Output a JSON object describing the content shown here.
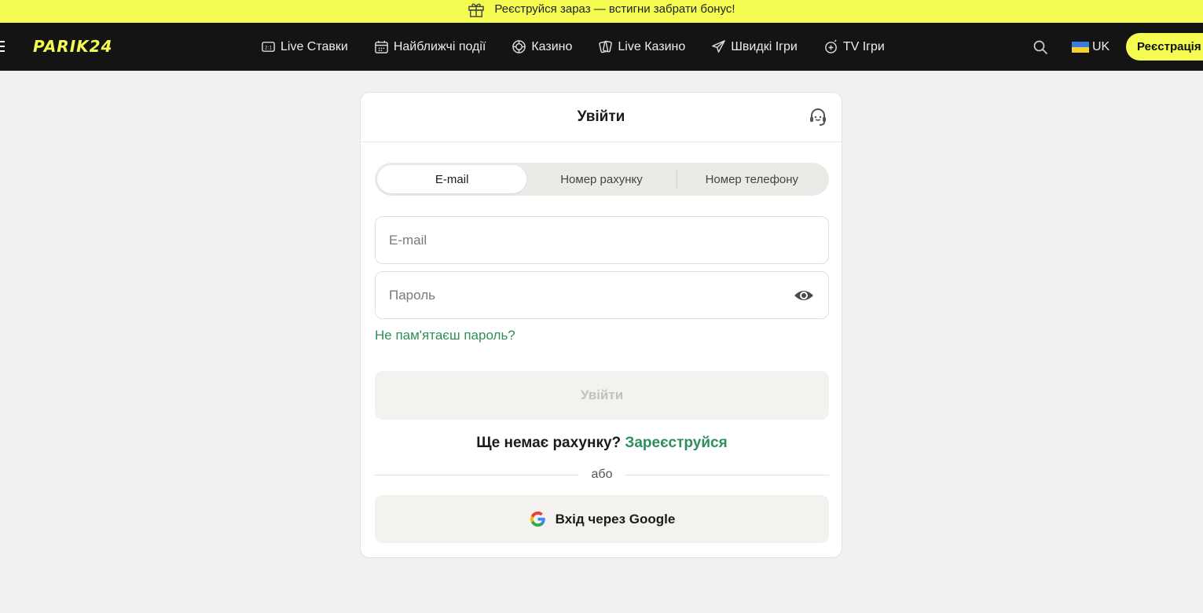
{
  "promo": {
    "text": "Реєструйся зараз — встигни забрати бонус!"
  },
  "header": {
    "logo": "PARIK24",
    "nav": [
      {
        "label": "Live Ставки",
        "icon": "live-bets-icon"
      },
      {
        "label": "Найближчі події",
        "icon": "calendar-icon"
      },
      {
        "label": "Казино",
        "icon": "casino-chip-icon"
      },
      {
        "label": "Live Казино",
        "icon": "cards-icon"
      },
      {
        "label": "Швидкі Ігри",
        "icon": "rocket-icon"
      },
      {
        "label": "TV Ігри",
        "icon": "tv-games-icon"
      }
    ],
    "language": "UK",
    "register_label": "Реєстрація"
  },
  "login": {
    "title": "Увійти",
    "tabs": [
      "E-mail",
      "Номер рахунку",
      "Номер телефону"
    ],
    "active_tab": 0,
    "email_placeholder": "E-mail",
    "password_placeholder": "Пароль",
    "forgot_password": "Не пам'ятаєш пароль?",
    "submit_label": "Увійти",
    "no_account_text": "Ще немає рахунку?",
    "register_link": "Зареєструйся",
    "or_text": "або",
    "google_label": "Вхід через Google"
  },
  "colors": {
    "accent_yellow": "#f4fc52",
    "header_bg": "#141414",
    "link_green": "#2e8f5a",
    "page_bg": "#f2f1ef"
  }
}
